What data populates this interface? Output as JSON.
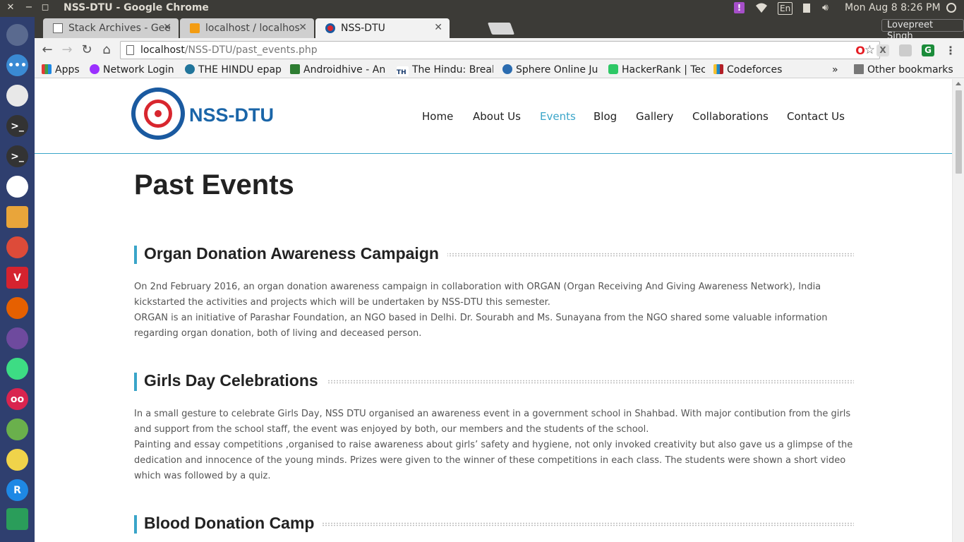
{
  "system": {
    "window_title": "NSS-DTU - Google Chrome",
    "keyboard_layout": "En",
    "clock": "Mon Aug  8  8:26 PM"
  },
  "browser": {
    "tabs": [
      {
        "label": "Stack Archives - Gee",
        "active": false
      },
      {
        "label": "localhost / localhos",
        "active": false
      },
      {
        "label": "NSS-DTU",
        "active": true
      }
    ],
    "profile_name": "Lovepreet Singh",
    "url_host": "localhost",
    "url_path": "/NSS-DTU/past_events.php",
    "bookmarks": [
      "Apps",
      "Network Login",
      "THE HINDU epap",
      "Androidhive - An",
      "The Hindu: Break",
      "Sphere Online Ju",
      "HackerRank | Tec",
      "Codeforces"
    ],
    "bookmarks_overflow": "»",
    "other_bookmarks": "Other bookmarks"
  },
  "site": {
    "brand": "NSS-DTU",
    "nav": [
      "Home",
      "About Us",
      "Events",
      "Blog",
      "Gallery",
      "Collaborations",
      "Contact Us"
    ],
    "active_nav": "Events",
    "accent_color": "#3aa5c9",
    "page_title": "Past Events",
    "events": [
      {
        "title": "Organ Donation Awareness Campaign",
        "paragraphs": [
          "On 2nd February 2016, an organ donation awareness campaign in collaboration with ORGAN (Organ Receiving And Giving Awareness Network), India kickstarted the activities and projects which will be undertaken by NSS-DTU this semester.",
          "ORGAN is an initiative of Parashar Foundation, an NGO based in Delhi. Dr. Sourabh and Ms. Sunayana from the NGO shared some valuable information regarding organ donation, both of living and deceased person."
        ]
      },
      {
        "title": "Girls Day Celebrations",
        "paragraphs": [
          "In a small gesture to celebrate Girls Day, NSS DTU organised an awareness event in a government school in Shahbad. With major contibution from the girls and support from the school staff, the event was enjoyed by both, our members and the students of the school.",
          "Painting and essay competitions ,organised to raise awareness about girls’ safety and hygiene, not only invoked creativity but also gave us a glimpse of the dedication and innocence of the young minds. Prizes were given to the winner of these competitions in each class. The students were shown a short video which was followed by a quiz."
        ]
      },
      {
        "title": "Blood Donation Camp",
        "paragraphs": []
      }
    ]
  }
}
